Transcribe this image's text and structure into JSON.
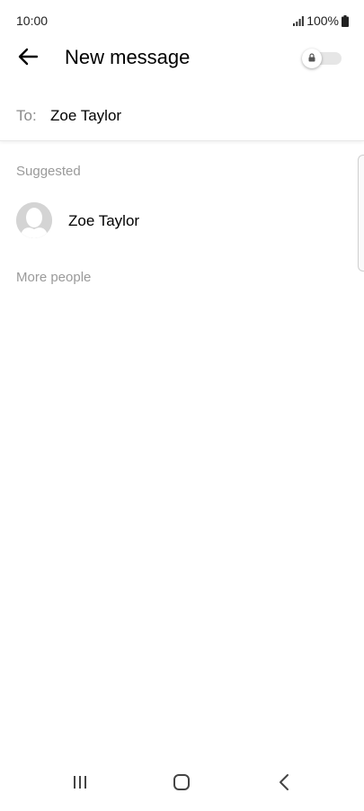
{
  "status_bar": {
    "time": "10:00",
    "battery": "100%",
    "icons": [
      "signal-icon",
      "battery-icon"
    ]
  },
  "app_bar": {
    "title": "New message",
    "icons": [
      "back-arrow-icon",
      "lock-icon"
    ],
    "secret_toggle_on": false
  },
  "recipient": {
    "label": "To:",
    "value": "Zoe Taylor"
  },
  "suggested": {
    "header": "Suggested",
    "contacts": [
      {
        "name": "Zoe Taylor",
        "icon": "avatar-placeholder-icon"
      }
    ]
  },
  "more_people": {
    "header": "More people"
  },
  "nav_bar": {
    "icons": [
      "recents-icon",
      "home-icon",
      "back-icon"
    ]
  },
  "colors": {
    "background": "#ffffff",
    "secondary_text": "#9a9a9a",
    "avatar_bg": "#d4d4d4"
  }
}
